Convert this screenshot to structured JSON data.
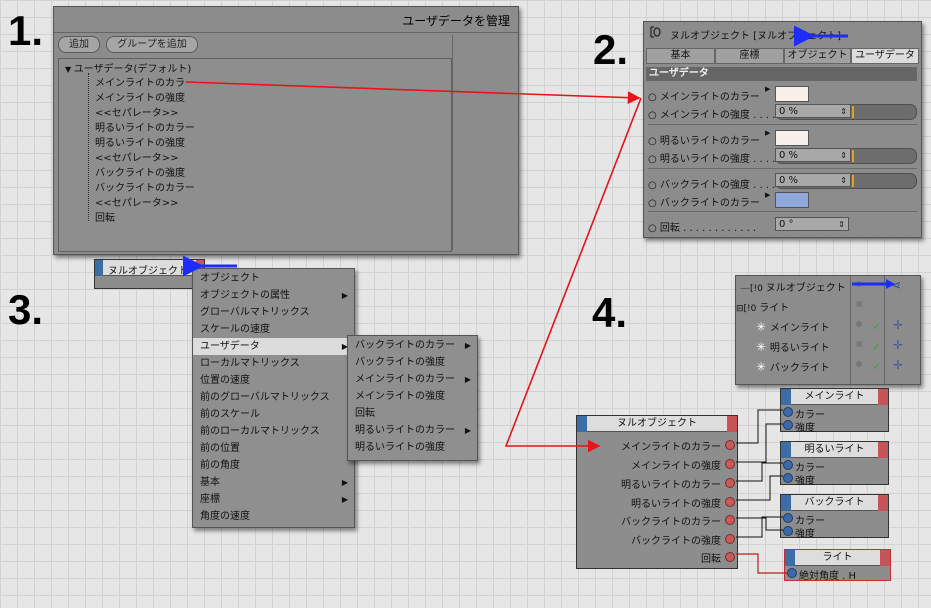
{
  "steps": [
    "1.",
    "2.",
    "3.",
    "4."
  ],
  "panel1": {
    "title": "ユーザデータを管理",
    "add_button": "追加",
    "add_group_button": "グループを追加",
    "root": "ユーザデータ(デフォルト)",
    "items": [
      "メインライトのカラー",
      "メインライトの強度",
      "<<セパレータ>>",
      "明るいライトのカラー",
      "明るいライトの強度",
      "<<セパレータ>>",
      "バックライトの強度",
      "バックライトのカラー",
      "<<セパレータ>>",
      "回転"
    ]
  },
  "panel2": {
    "header": "ヌルオブジェクト [ヌルオブジェクト]",
    "tabs": [
      "基本",
      "座標",
      "オブジェクト",
      "ユーザデータ"
    ],
    "section": "ユーザデータ",
    "rows": [
      {
        "label": "メインライトのカラー",
        "kind": "color",
        "color": "#f7efe9"
      },
      {
        "label": "メインライトの強度",
        "kind": "slider",
        "value": "0 %"
      },
      {
        "label": "明るいライトのカラー",
        "kind": "color",
        "color": "#f7efe9"
      },
      {
        "label": "明るいライトの強度",
        "kind": "slider",
        "value": "0 %"
      },
      {
        "label": "バックライトの強度",
        "kind": "slider",
        "value": "0 %"
      },
      {
        "label": "バックライトのカラー",
        "kind": "color",
        "color": "#8fa8dc"
      },
      {
        "label": "回転",
        "kind": "field",
        "value": "0 °"
      }
    ]
  },
  "panel3": {
    "node_title": "ヌルオブジェクト",
    "menu": [
      "オブジェクト",
      "オブジェクトの属性",
      "グローバルマトリックス",
      "スケールの速度",
      "ユーザデータ",
      "ローカルマトリックス",
      "位置の速度",
      "前のグローバルマトリックス",
      "前のスケール",
      "前のローカルマトリックス",
      "前の位置",
      "前の角度",
      "基本",
      "座標",
      "角度の速度"
    ],
    "submenu": [
      "バックライトのカラー",
      "バックライトの強度",
      "メインライトのカラー",
      "メインライトの強度",
      "回転",
      "明るいライトのカラー",
      "明るいライトの強度"
    ]
  },
  "panel4": {
    "objects": [
      "ヌルオブジェクト",
      "ライト",
      "メインライト",
      "明るいライト",
      "バックライト"
    ]
  },
  "xpresso": {
    "null_node": {
      "title": "ヌルオブジェクト",
      "ports": [
        "メインライトのカラー",
        "メインライトの強度",
        "明るいライトのカラー",
        "明るいライトの強度",
        "バックライトのカラー",
        "バックライトの強度",
        "回転"
      ]
    },
    "light_nodes": [
      {
        "title": "メインライト",
        "ports": [
          "カラー",
          "強度"
        ]
      },
      {
        "title": "明るいライト",
        "ports": [
          "カラー",
          "強度"
        ]
      },
      {
        "title": "バックライト",
        "ports": [
          "カラー",
          "強度"
        ]
      },
      {
        "title": "ライト",
        "ports": [
          "絶対角度 . H"
        ]
      }
    ]
  },
  "colors": {
    "arrow_red": "#e8141a",
    "arrow_blue": "#1e2cff"
  }
}
